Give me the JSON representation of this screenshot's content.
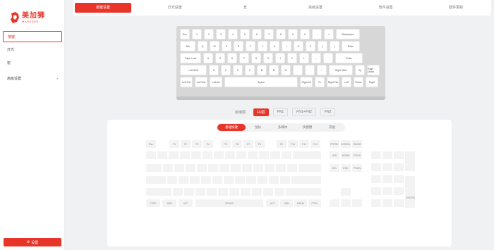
{
  "brand": {
    "name": "美加狮",
    "sub": "MAGEGEE"
  },
  "sidebar": {
    "items": [
      {
        "label": "按键"
      },
      {
        "label": "灯光"
      },
      {
        "label": "宏"
      },
      {
        "label": "高级设置",
        "arrow": "›"
      }
    ],
    "button_label": "设置"
  },
  "top_tabs": [
    "按键设置",
    "灯光设置",
    "宏",
    "高级设置",
    "软件设置",
    "固件更新"
  ],
  "layers": [
    "标准层",
    "FN层",
    "FN1",
    "FN1+FN2",
    "FN2"
  ],
  "categories": [
    "基础按键",
    "鼠标",
    "多媒体",
    "快捷键",
    "其他"
  ],
  "keyboard_preview": {
    "rows": [
      [
        "Esc",
        "1",
        "2",
        "3",
        "4",
        "5",
        "6",
        "7",
        "8",
        "9",
        "0",
        "-",
        "=",
        "Backspace"
      ],
      [
        "Tab",
        "Q",
        "W",
        "E",
        "R",
        "T",
        "Y",
        "U",
        "I",
        "O",
        "P",
        "[",
        "]",
        "Enter"
      ],
      [
        "Caps Lock",
        "A",
        "S",
        "D",
        "F",
        "G",
        "H",
        "J",
        "K",
        "L",
        ";",
        "'",
        "Enter"
      ],
      [
        "Left Shift",
        "Z",
        "X",
        "C",
        "V",
        "B",
        "N",
        "M",
        ",",
        ".",
        "/",
        "Right Shift",
        "Up",
        "Page Down"
      ],
      [
        "Left Ctrl",
        "Left Win",
        "Left Alt",
        "Space",
        "Right Alt",
        "Fn",
        "Right Ctrl",
        "Left",
        "Down",
        "Right"
      ]
    ]
  },
  "full_keyboard": {
    "row0": [
      "Esc",
      "F1",
      "F2",
      "F3",
      "F4",
      "F5",
      "F6",
      "F7",
      "F8",
      "F9",
      "F10",
      "F11",
      "F12",
      "PRTSC",
      "SCROLL",
      "PAUSE"
    ],
    "space_label": "SPACE",
    "bottom_mods": [
      "CTRL",
      "WIN",
      "ALT"
    ],
    "bottom_right": [
      "ALT",
      "WIN",
      "MENU",
      "CTRL"
    ],
    "nav_top": [
      "INS",
      "HOME",
      "PGUP"
    ],
    "nav_mid": [
      "DEL",
      "END",
      "PGDN"
    ],
    "numpad_enter": "ENTER"
  }
}
